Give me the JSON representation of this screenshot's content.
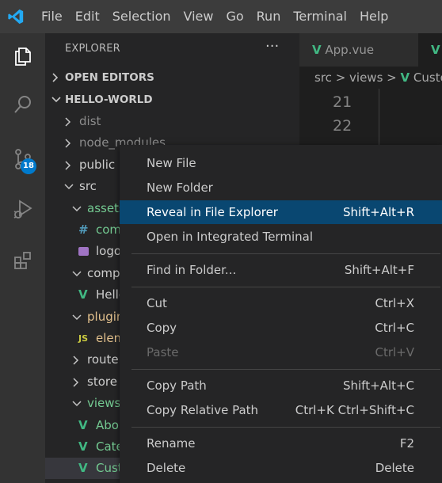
{
  "menubar": {
    "items": [
      "File",
      "Edit",
      "Selection",
      "View",
      "Go",
      "Run",
      "Terminal",
      "Help"
    ],
    "logo_icon": "vscode-logo-icon"
  },
  "activity_bar": {
    "icons": [
      "explorer-icon",
      "search-icon",
      "source-control-icon",
      "run-debug-icon",
      "extensions-icon"
    ],
    "scm_badge": "18"
  },
  "sidebar": {
    "title": "EXPLORER",
    "more_label": "···",
    "open_editors": "OPEN EDITORS",
    "workspace": "HELLO-WORLD",
    "tree": [
      {
        "label": "dist",
        "type": "folder-collapsed",
        "depth": 1,
        "status": "muted"
      },
      {
        "label": "node_modules",
        "type": "folder-collapsed",
        "depth": 1,
        "status": "muted"
      },
      {
        "label": "public",
        "type": "folder-collapsed",
        "depth": 1,
        "status": "normal"
      },
      {
        "label": "src",
        "type": "folder-expanded",
        "depth": 1,
        "status": "normal"
      },
      {
        "label": "assets",
        "type": "folder-expanded",
        "depth": 2,
        "status": "green"
      },
      {
        "label": "com",
        "type": "file-css",
        "depth": 3,
        "status": "green"
      },
      {
        "label": "logo",
        "type": "file-image",
        "depth": 3,
        "status": "normal"
      },
      {
        "label": "compo",
        "type": "folder-expanded",
        "depth": 2,
        "status": "normal"
      },
      {
        "label": "Hello",
        "type": "file-vue",
        "depth": 3,
        "status": "normal"
      },
      {
        "label": "plugin",
        "type": "folder-expanded",
        "depth": 2,
        "status": "yellow"
      },
      {
        "label": "elem",
        "type": "file-js",
        "depth": 3,
        "status": "yellow"
      },
      {
        "label": "router",
        "type": "folder-collapsed",
        "depth": 2,
        "status": "normal"
      },
      {
        "label": "store",
        "type": "folder-collapsed",
        "depth": 2,
        "status": "normal"
      },
      {
        "label": "views",
        "type": "folder-expanded",
        "depth": 2,
        "status": "green"
      },
      {
        "label": "Abou",
        "type": "file-vue",
        "depth": 3,
        "status": "green"
      },
      {
        "label": "Cate",
        "type": "file-vue",
        "depth": 3,
        "status": "green"
      },
      {
        "label": "Cust",
        "type": "file-vue",
        "depth": 3,
        "status": "green",
        "selected": true
      }
    ]
  },
  "editor": {
    "tabs": [
      {
        "label": "App.vue",
        "icon": "vue-file-icon"
      },
      {
        "label": "",
        "icon": "vue-file-icon"
      }
    ],
    "breadcrumb": [
      "src",
      "views",
      "Custo"
    ],
    "line_numbers": [
      "21",
      "22"
    ]
  },
  "context_menu": {
    "groups": [
      [
        {
          "label": "New File",
          "shortcut": ""
        },
        {
          "label": "New Folder",
          "shortcut": ""
        },
        {
          "label": "Reveal in File Explorer",
          "shortcut": "Shift+Alt+R",
          "active": true
        },
        {
          "label": "Open in Integrated Terminal",
          "shortcut": ""
        }
      ],
      [
        {
          "label": "Find in Folder...",
          "shortcut": "Shift+Alt+F"
        }
      ],
      [
        {
          "label": "Cut",
          "shortcut": "Ctrl+X"
        },
        {
          "label": "Copy",
          "shortcut": "Ctrl+C"
        },
        {
          "label": "Paste",
          "shortcut": "Ctrl+V",
          "disabled": true
        }
      ],
      [
        {
          "label": "Copy Path",
          "shortcut": "Shift+Alt+C"
        },
        {
          "label": "Copy Relative Path",
          "shortcut": "Ctrl+K Ctrl+Shift+C"
        }
      ],
      [
        {
          "label": "Rename",
          "shortcut": "F2"
        },
        {
          "label": "Delete",
          "shortcut": "Delete"
        }
      ]
    ]
  },
  "colors": {
    "accent": "#007acc",
    "menu_highlight": "#094771",
    "vue_green": "#41b883",
    "git_untracked": "#73c991",
    "git_modified": "#e2c08d"
  }
}
